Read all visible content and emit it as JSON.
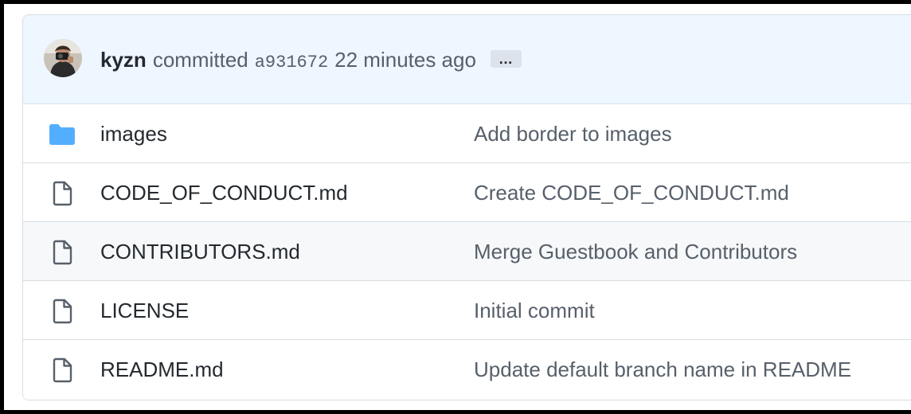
{
  "commit": {
    "author": "kyzn",
    "verb": "committed",
    "sha": "a931672",
    "time": "22 minutes ago",
    "more": "…"
  },
  "icons": {
    "folder": "folder-icon",
    "file": "file-icon",
    "avatar": "user-avatar"
  },
  "colors": {
    "header_bg": "#eef6ff",
    "folder": "#54aeff",
    "file_icon": "#57606a"
  },
  "files": [
    {
      "type": "folder",
      "name": "images",
      "message": "Add border to images"
    },
    {
      "type": "file",
      "name": "CODE_OF_CONDUCT.md",
      "message": "Create CODE_OF_CONDUCT.md"
    },
    {
      "type": "file",
      "name": "CONTRIBUTORS.md",
      "message": "Merge Guestbook and Contributors"
    },
    {
      "type": "file",
      "name": "LICENSE",
      "message": "Initial commit"
    },
    {
      "type": "file",
      "name": "README.md",
      "message": "Update default branch name in README"
    }
  ]
}
